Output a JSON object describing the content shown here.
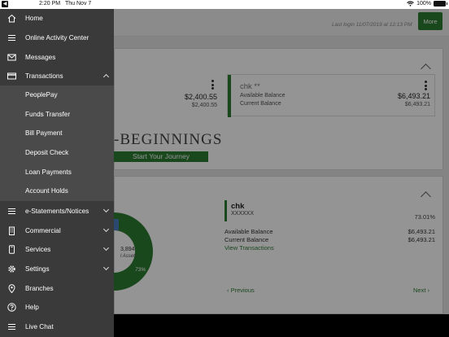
{
  "status_bar": {
    "back_glyph": "◀",
    "time": "2:20 PM",
    "date": "Thu Nov 7",
    "battery": "100%"
  },
  "header": {
    "last_login": "Last login 11/07/2019 at 12:13 PM",
    "more_label": "More"
  },
  "accounts": [
    {
      "available": "$2,400.55",
      "current": "$2,400.55"
    },
    {
      "name": "chk **",
      "available_label": "Available Balance",
      "current_label": "Current Balance",
      "available": "$6,493.21",
      "current": "$6,493.21"
    }
  ],
  "promo": {
    "title": "-Beginnings",
    "button": "Start Your Journey"
  },
  "assets": {
    "total": "3,894",
    "total_label": "l Assets",
    "slice_pct": "73%",
    "detail": {
      "name": "chk",
      "account": "XXXXXX",
      "pct": "73.01%",
      "available_label": "Available Balance",
      "available": "$6,493.21",
      "current_label": "Current Balance",
      "current": "$6,493.21",
      "link": "View Transactions"
    },
    "prev_label": "Previous",
    "next_label": "Next"
  },
  "sidebar": {
    "items": [
      {
        "label": "Home",
        "icon": "home-icon"
      },
      {
        "label": "Online Activity Center",
        "icon": "list-icon"
      },
      {
        "label": "Messages",
        "icon": "envelope-icon"
      },
      {
        "label": "Transactions",
        "icon": "card-icon",
        "expanded": true
      },
      {
        "label": "e-Statements/Notices",
        "icon": "list-icon"
      },
      {
        "label": "Commercial",
        "icon": "building-icon"
      },
      {
        "label": "Services",
        "icon": "phone-icon"
      },
      {
        "label": "Settings",
        "icon": "gear-icon"
      },
      {
        "label": "Branches",
        "icon": "location-icon"
      },
      {
        "label": "Help",
        "icon": "help-icon"
      },
      {
        "label": "Live Chat",
        "icon": "list-icon"
      }
    ],
    "sub_items": [
      {
        "label": "PeoplePay"
      },
      {
        "label": "Funds Transfer"
      },
      {
        "label": "Bill Payment"
      },
      {
        "label": "Deposit Check"
      },
      {
        "label": "Loan Payments"
      },
      {
        "label": "Account Holds"
      }
    ]
  },
  "colors": {
    "accent": "#2e7d32",
    "sidebar": "#3a3a3a",
    "submenu": "#4a4a4a"
  }
}
